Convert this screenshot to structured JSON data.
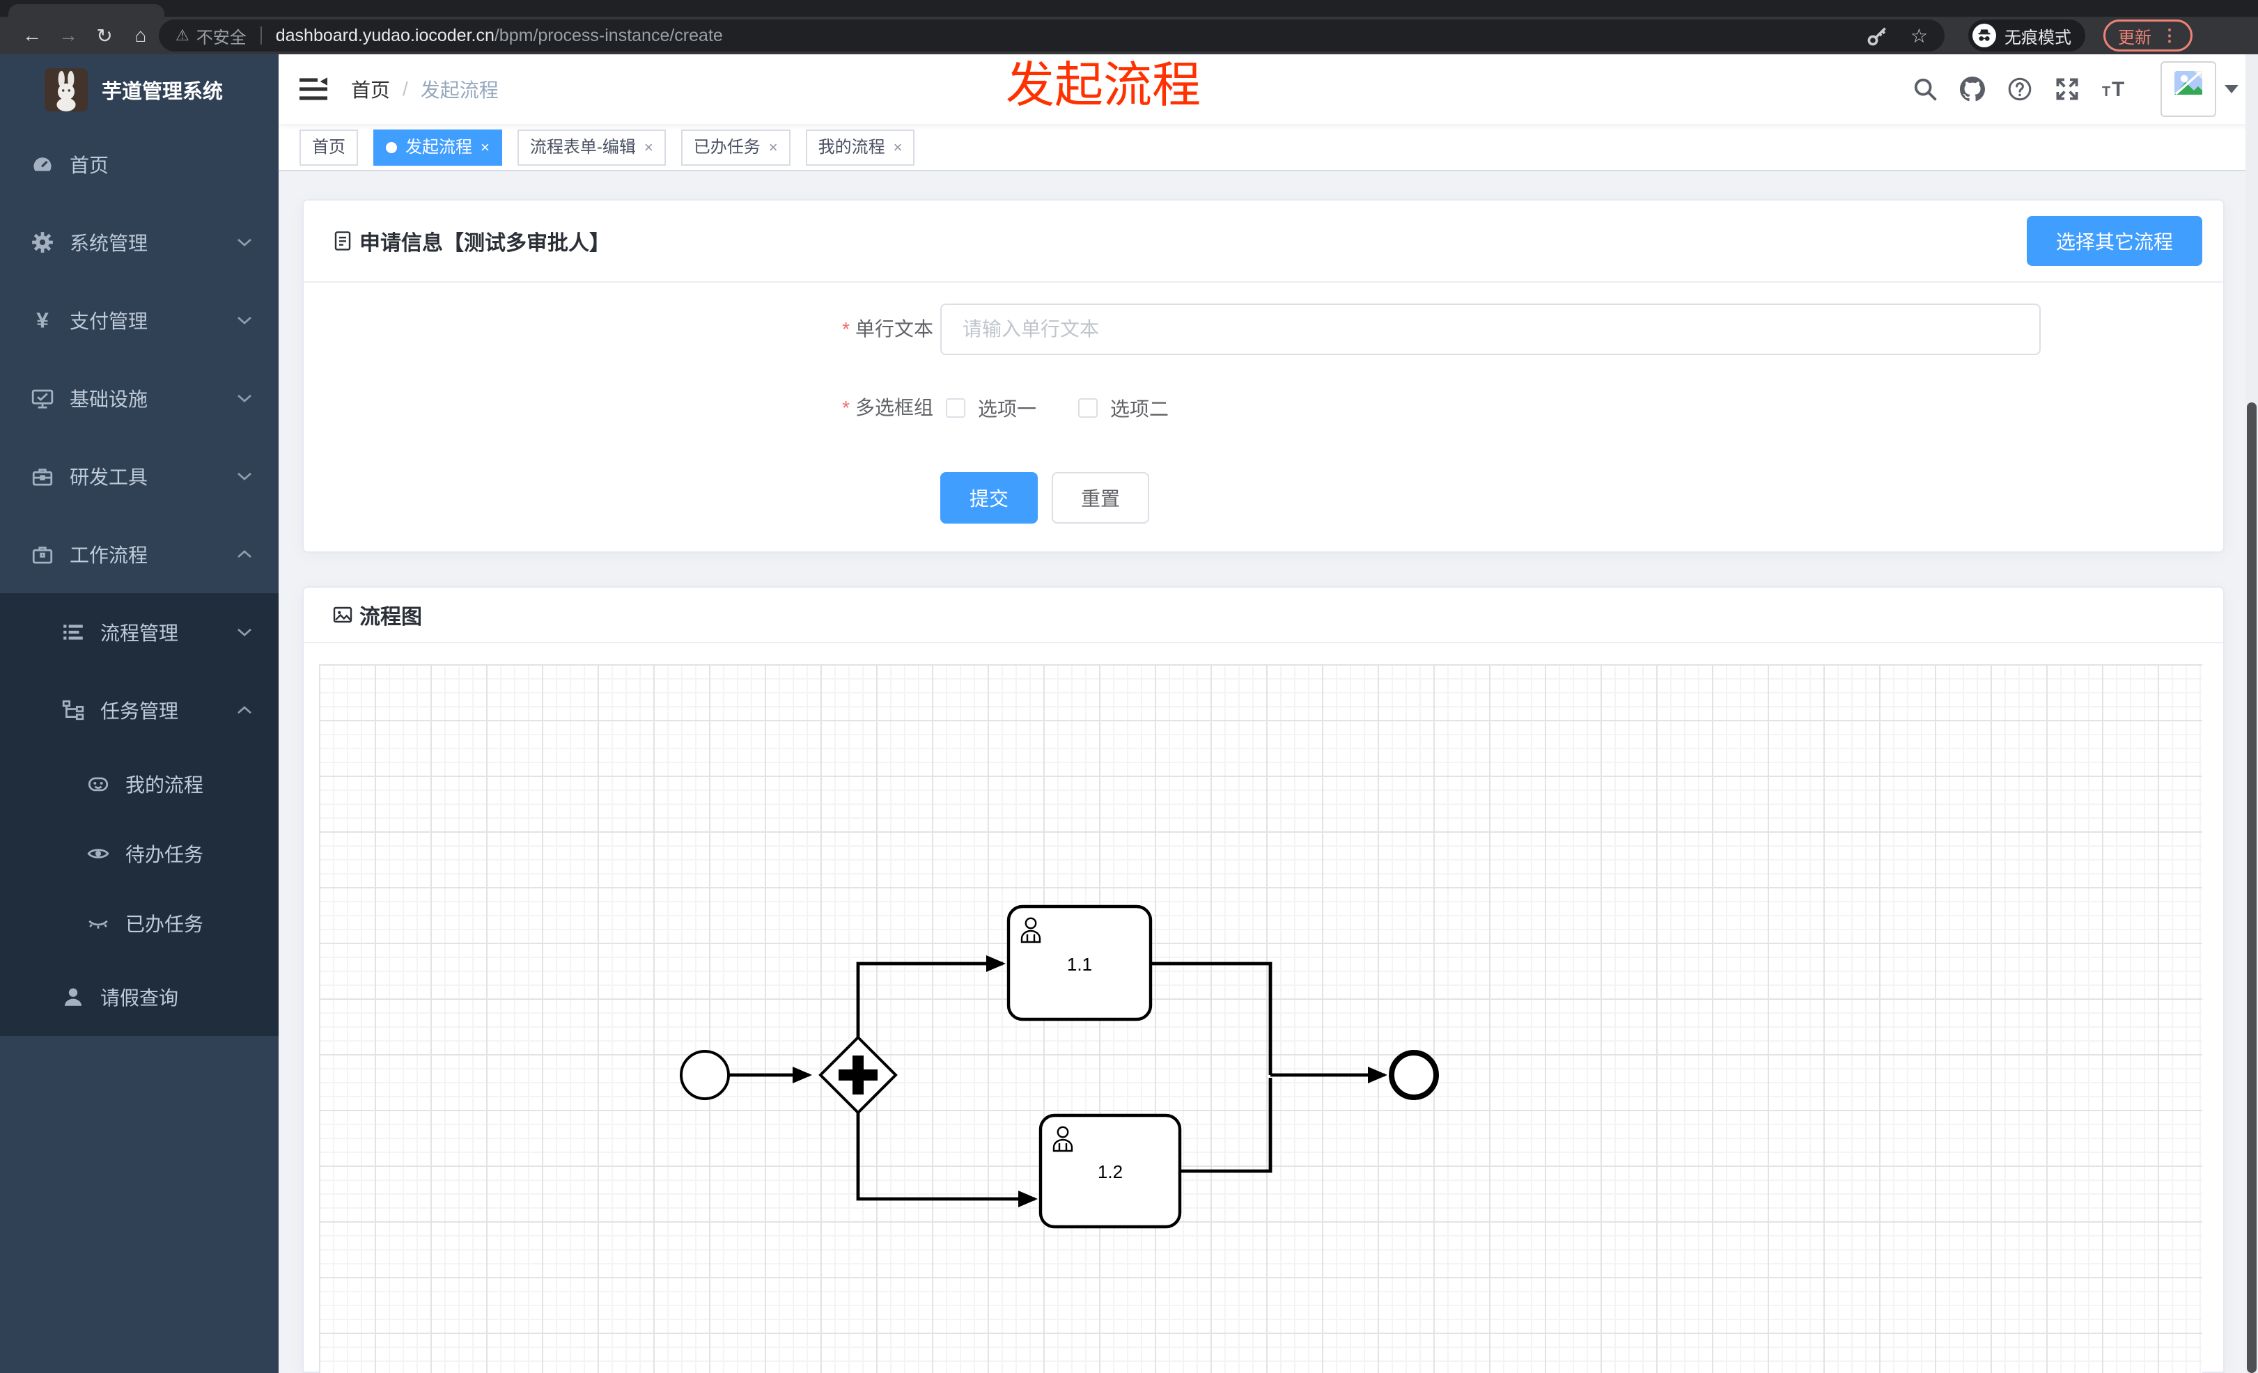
{
  "browser": {
    "security_label": "不安全",
    "url_host": "dashboard.yudao.iocoder.cn",
    "url_path": "/bpm/process-instance/create",
    "incognito_label": "无痕模式",
    "update_label": "更新",
    "nav": {
      "back": "←",
      "forward": "→",
      "reload": "↻",
      "home": "⌂"
    }
  },
  "icons": {
    "close": "×",
    "star": "☆",
    "warning": "⚠",
    "dots": "⋮"
  },
  "overlay": {
    "text": "发起流程",
    "color": "#ff3100"
  },
  "sidebar": {
    "app_title": "芋道管理系统",
    "items": [
      {
        "label": "首页",
        "icon": "gauge-icon"
      },
      {
        "label": "系统管理",
        "icon": "gear-icon",
        "chevron": "down"
      },
      {
        "label": "支付管理",
        "icon": "yen-icon",
        "chevron": "down"
      },
      {
        "label": "基础设施",
        "icon": "monitor-icon",
        "chevron": "down"
      },
      {
        "label": "研发工具",
        "icon": "toolbox-icon",
        "chevron": "down"
      },
      {
        "label": "工作流程",
        "icon": "briefcase-icon",
        "chevron": "up"
      },
      {
        "label": "流程管理",
        "icon": "list-icon",
        "chevron": "down"
      },
      {
        "label": "任务管理",
        "icon": "tree-icon",
        "chevron": "up"
      },
      {
        "label": "我的流程",
        "icon": "robot-icon"
      },
      {
        "label": "待办任务",
        "icon": "eye-icon"
      },
      {
        "label": "已办任务",
        "icon": "eye-closed-icon"
      },
      {
        "label": "请假查询",
        "icon": "user-icon"
      }
    ]
  },
  "navbar": {
    "breadcrumb": {
      "home": "首页",
      "separator": "/",
      "current": "发起流程"
    }
  },
  "tags": [
    {
      "label": "首页"
    },
    {
      "label": "发起流程"
    },
    {
      "label": "流程表单-编辑"
    },
    {
      "label": "已办任务"
    },
    {
      "label": "我的流程"
    }
  ],
  "form_card": {
    "title": "申请信息【测试多审批人】",
    "choose_other_button": "选择其它流程",
    "text_field": {
      "label": "单行文本",
      "required": true,
      "placeholder": "请输入单行文本",
      "value": ""
    },
    "checkbox_group": {
      "label": "多选框组",
      "required": true,
      "options": [
        "选项一",
        "选项二"
      ],
      "checked": [
        false,
        false
      ]
    },
    "submit_label": "提交",
    "reset_label": "重置"
  },
  "diagram_card": {
    "title": "流程图",
    "bpmn": {
      "type": "process",
      "nodes": [
        {
          "id": "start",
          "kind": "start-event"
        },
        {
          "id": "gateway",
          "kind": "parallel-gateway"
        },
        {
          "id": "task1",
          "kind": "user-task",
          "label": "1.1"
        },
        {
          "id": "task2",
          "kind": "user-task",
          "label": "1.2"
        },
        {
          "id": "end",
          "kind": "end-event"
        }
      ],
      "edges": [
        "start→gateway",
        "gateway→task1",
        "gateway→task2",
        "task1→end",
        "task2→end"
      ]
    }
  },
  "colors": {
    "accent": "#409eff",
    "sidebar_bg": "#304156",
    "submenu_bg": "#1f2d3d",
    "overlay_red": "#ff3100",
    "update_pill": "#ee8277"
  }
}
